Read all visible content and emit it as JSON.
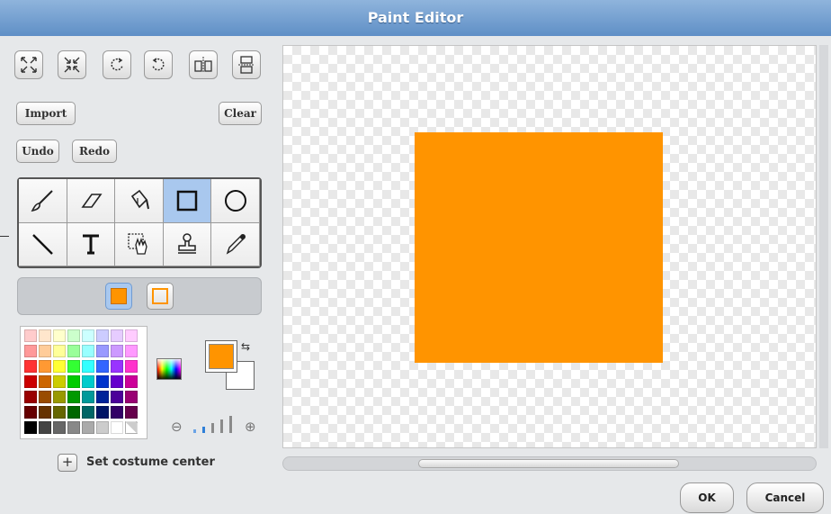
{
  "window": {
    "title": "Paint Editor"
  },
  "toolbar": {
    "import_label": "Import",
    "clear_label": "Clear",
    "undo_label": "Undo",
    "redo_label": "Redo"
  },
  "tools": {
    "selected": "rectangle"
  },
  "colors": {
    "foreground": "#ff9400",
    "background": "#ffffff",
    "palette": [
      "#ffcccc",
      "#ffe6cc",
      "#ffffcc",
      "#ccffcc",
      "#ccffff",
      "#ccccff",
      "#e6ccff",
      "#ffccff",
      "#ff9999",
      "#ffcc99",
      "#ffff99",
      "#99ff99",
      "#99ffff",
      "#9999ff",
      "#cc99ff",
      "#ff99ff",
      "#ff3333",
      "#ff9933",
      "#ffff33",
      "#33ff33",
      "#33ffff",
      "#3366ff",
      "#9933ff",
      "#ff33cc",
      "#cc0000",
      "#cc6600",
      "#cccc00",
      "#00cc00",
      "#00cccc",
      "#0033cc",
      "#6600cc",
      "#cc0099",
      "#990000",
      "#994c00",
      "#999900",
      "#009900",
      "#009999",
      "#002299",
      "#4c0099",
      "#990073",
      "#660000",
      "#663300",
      "#666600",
      "#006600",
      "#006666",
      "#001466",
      "#330066",
      "#66004c",
      "#000000",
      "#444444",
      "#666666",
      "#888888",
      "#aaaaaa",
      "#cccccc",
      "#ffffff",
      "#transparent"
    ]
  },
  "costume_center": {
    "label": "Set costume center"
  },
  "canvas": {
    "shape_color": "#ff9400"
  },
  "dialog": {
    "ok_label": "OK",
    "cancel_label": "Cancel"
  }
}
